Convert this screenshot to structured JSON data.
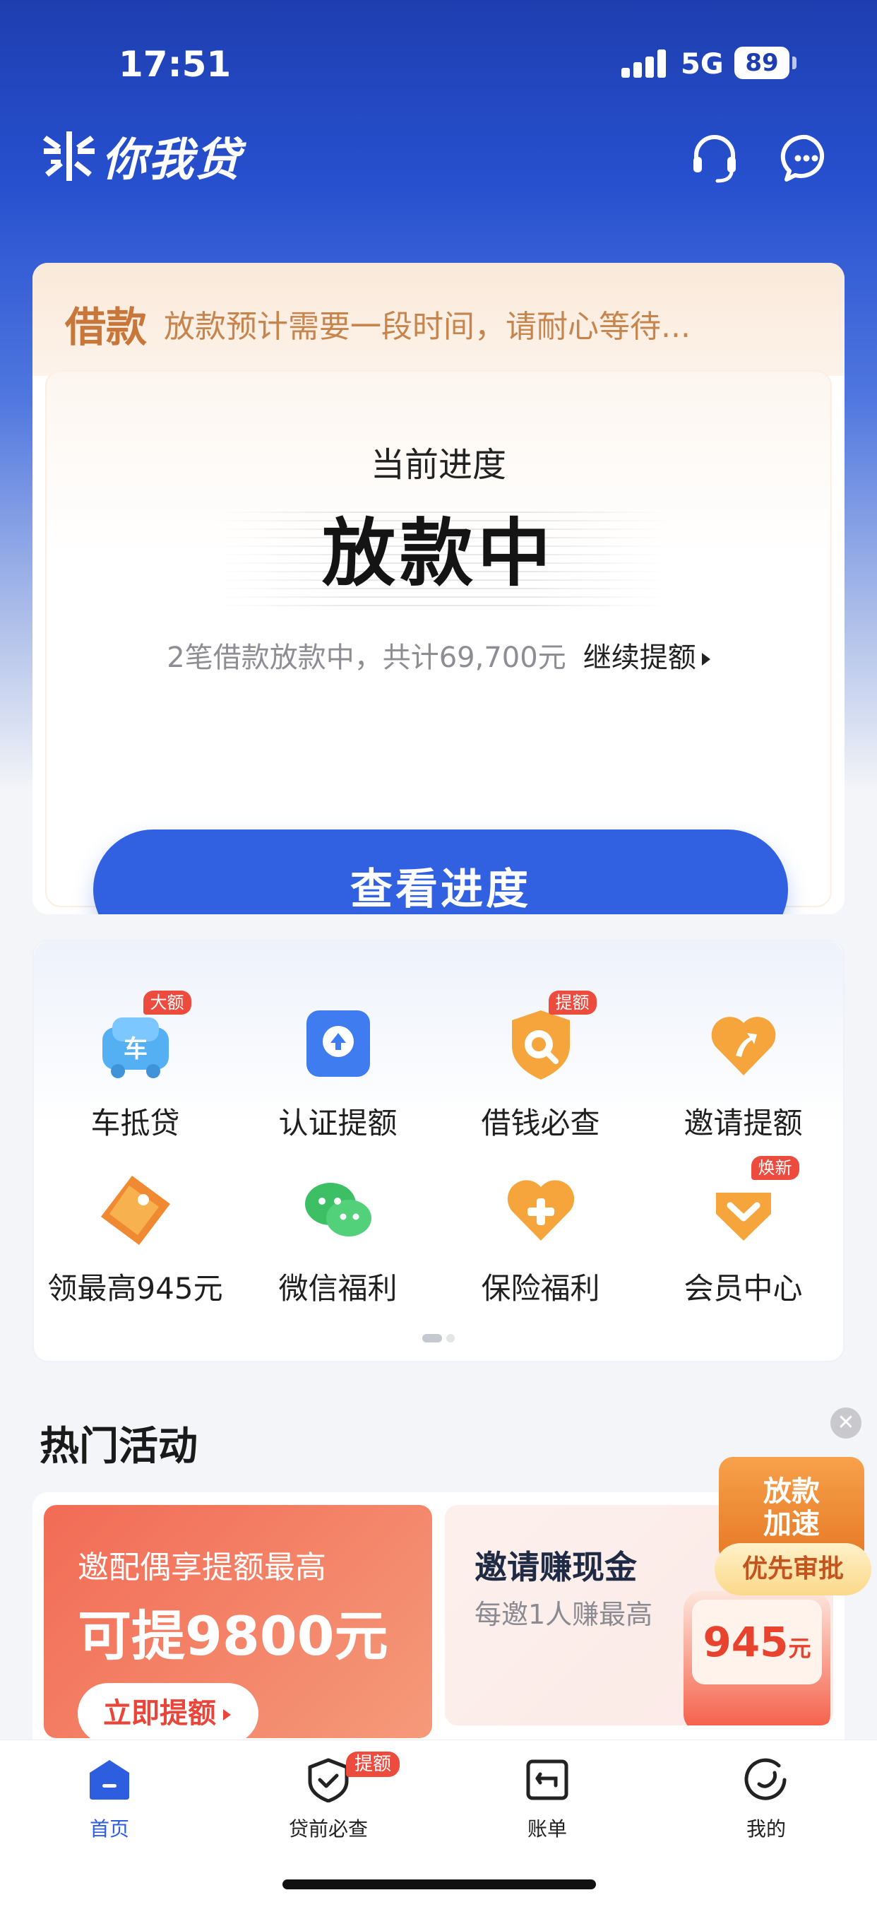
{
  "status_bar": {
    "time": "17:51",
    "network": "5G",
    "battery": "89"
  },
  "header": {
    "app_name": "你我贷"
  },
  "loan_card": {
    "tag": "借款",
    "notice": "放款预计需要一段时间，请耐心等待...",
    "progress_label": "当前进度",
    "progress_status": "放款中",
    "summary": "2笔借款放款中，共计69,700元",
    "more_link": "继续提额",
    "cta": "查看进度"
  },
  "quick_menu": {
    "items": [
      {
        "label": "车抵贷",
        "badge": "大额",
        "icon": "car-icon"
      },
      {
        "label": "认证提额",
        "badge": "",
        "icon": "upload-arrow-icon"
      },
      {
        "label": "借钱必查",
        "badge": "提额",
        "icon": "shield-search-icon"
      },
      {
        "label": "邀请提额",
        "badge": "",
        "icon": "heart-arrow-icon"
      },
      {
        "label": "领最高945元",
        "badge": "",
        "icon": "coupon-icon"
      },
      {
        "label": "微信福利",
        "badge": "",
        "icon": "wechat-icon"
      },
      {
        "label": "保险福利",
        "badge": "",
        "icon": "heart-plus-icon"
      },
      {
        "label": "会员中心",
        "badge": "焕新",
        "icon": "member-heart-icon"
      }
    ],
    "page_indicator": {
      "pages": 2,
      "current": 1
    }
  },
  "hot": {
    "title": "热门活动",
    "promo1": {
      "line1": "邀配偶享提额最高",
      "line2": "可提9800元",
      "button": "立即提额"
    },
    "promo2": {
      "line1": "邀请赚现金",
      "line2": "每邀1人赚最高",
      "amount": "945",
      "unit": "元"
    }
  },
  "float_ad": {
    "line1": "放款",
    "line2": "加速",
    "pill": "优先审批"
  },
  "tabbar": {
    "items": [
      {
        "label": "首页",
        "active": true,
        "icon": "home-icon"
      },
      {
        "label": "贷前必查",
        "active": false,
        "icon": "shield-check-icon",
        "badge": "提额"
      },
      {
        "label": "账单",
        "active": false,
        "icon": "bill-icon"
      },
      {
        "label": "我的",
        "active": false,
        "icon": "profile-icon"
      }
    ]
  },
  "colors": {
    "primary": "#3161E0",
    "header_bg": "#1E3EB0",
    "accent_orange": "#F29B3F",
    "badge_red": "#EC4B3E"
  }
}
